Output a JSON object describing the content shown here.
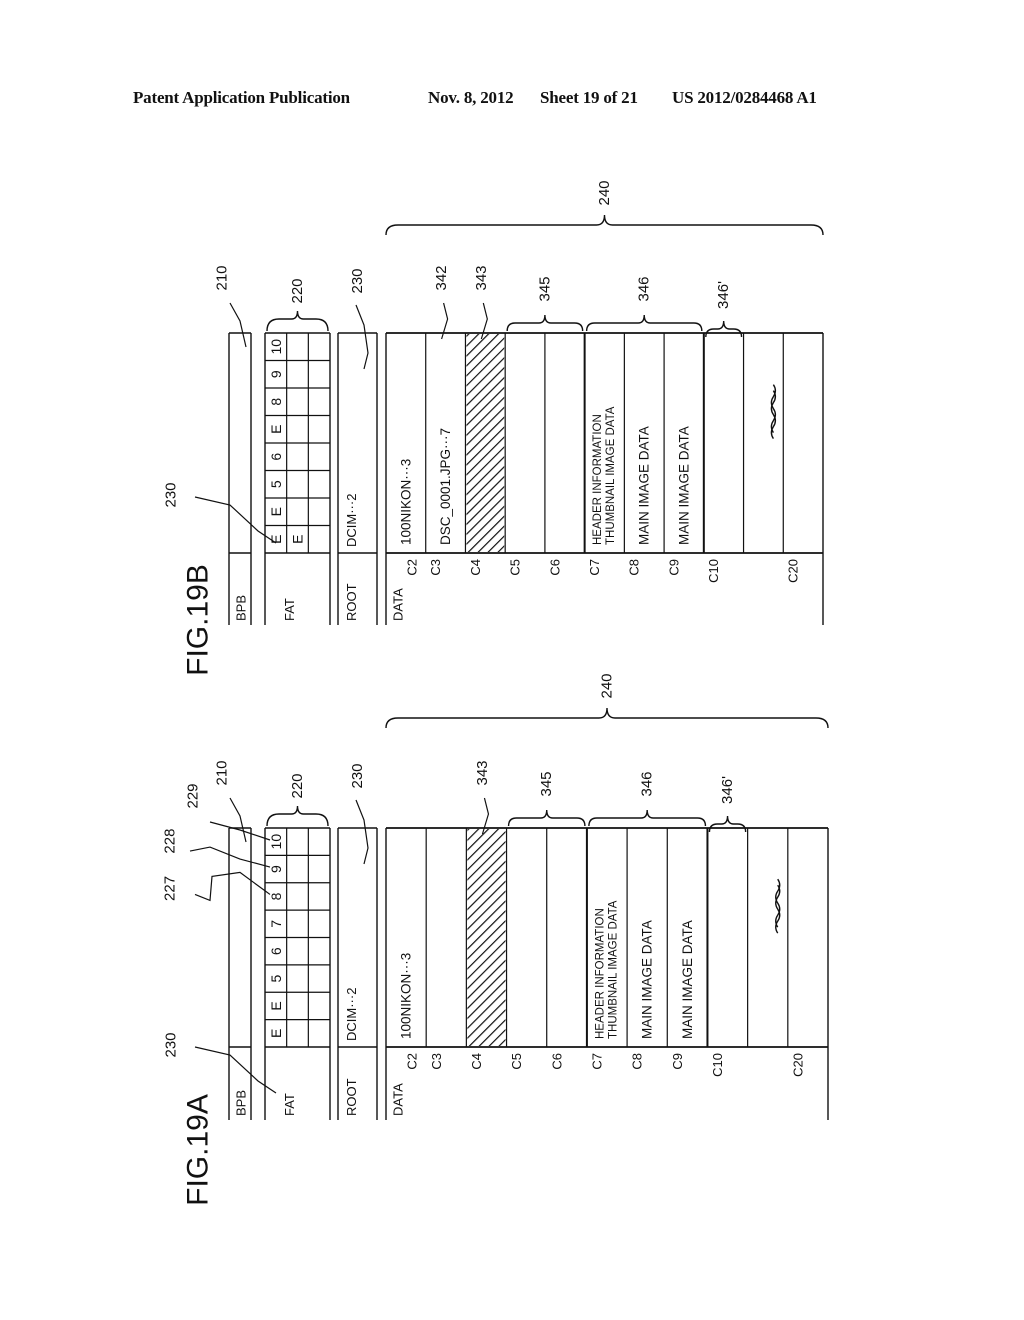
{
  "header": {
    "publication": "Patent Application Publication",
    "date": "Nov. 8, 2012",
    "sheet": "Sheet 19 of 21",
    "number": "US 2012/0284468 A1"
  },
  "figures": [
    {
      "id": "19B",
      "title": "FIG.19B",
      "regions": {
        "bpb": "BPB",
        "fat": "FAT",
        "root": "ROOT",
        "data": "DATA"
      },
      "refs": {
        "bpb": "210",
        "fat": "220",
        "root": "230",
        "data": "240",
        "fat_pointer": "230"
      },
      "fat_rows": [
        [
          "E",
          "E",
          "5",
          "6",
          "E",
          "8",
          "9",
          "10"
        ],
        [
          "E",
          "",
          "",
          "",
          "",
          "",
          "",
          ""
        ],
        [
          "",
          "",
          "",
          "",
          "",
          "",
          "",
          ""
        ]
      ],
      "root_entry": "DCIM···2",
      "clusters": [
        {
          "label": "C2",
          "content": [
            "100NIKON···3"
          ],
          "hatched": false
        },
        {
          "label": "C3",
          "content": [
            "DSC_0001.JPG···7"
          ],
          "hatched": false
        },
        {
          "label": "C4",
          "content": [],
          "hatched": true
        },
        {
          "label": "C5",
          "content": [],
          "hatched": false
        },
        {
          "label": "C6",
          "content": [],
          "hatched": false
        },
        {
          "label": "C7",
          "content": [
            "HEADER INFORMATION",
            "THUMBNAIL IMAGE DATA"
          ],
          "hatched": false
        },
        {
          "label": "C8",
          "content": [
            "MAIN IMAGE DATA"
          ],
          "hatched": false
        },
        {
          "label": "C9",
          "content": [
            "MAIN IMAGE DATA"
          ],
          "hatched": false
        },
        {
          "label": "C10",
          "content": [],
          "hatched": false
        },
        {
          "label": "",
          "content": [],
          "hatched": false
        },
        {
          "label": "C20",
          "content": [],
          "hatched": false
        }
      ],
      "cluster_refs": [
        {
          "text": "342",
          "kind": "leader",
          "cluster": 1
        },
        {
          "text": "343",
          "kind": "leader",
          "cluster": 2
        },
        {
          "text": "345",
          "kind": "brace",
          "from": 3,
          "to": 4
        },
        {
          "text": "346",
          "kind": "brace",
          "from": 5,
          "to": 7
        },
        {
          "text": "346'",
          "kind": "brace",
          "from": 8,
          "to": 8
        }
      ],
      "break_symbol": "≈"
    },
    {
      "id": "19A",
      "title": "FIG.19A",
      "regions": {
        "bpb": "BPB",
        "fat": "FAT",
        "root": "ROOT",
        "data": "DATA"
      },
      "refs": {
        "bpb": "210",
        "fat": "220",
        "root": "230",
        "data": "240",
        "fat_pointer": "230",
        "entry_227": "227",
        "entry_228": "228",
        "entry_229": "229"
      },
      "fat_rows": [
        [
          "E",
          "E",
          "5",
          "6",
          "7",
          "8",
          "9",
          "10"
        ],
        [
          "",
          "",
          "",
          "",
          "",
          "",
          "",
          ""
        ],
        [
          "",
          "",
          "",
          "",
          "",
          "",
          "",
          ""
        ]
      ],
      "root_entry": "DCIM···2",
      "clusters": [
        {
          "label": "C2",
          "content": [
            "100NIKON···3"
          ],
          "hatched": false
        },
        {
          "label": "C3",
          "content": [],
          "hatched": false
        },
        {
          "label": "C4",
          "content": [],
          "hatched": true
        },
        {
          "label": "C5",
          "content": [],
          "hatched": false
        },
        {
          "label": "C6",
          "content": [],
          "hatched": false
        },
        {
          "label": "C7",
          "content": [
            "HEADER INFORMATION",
            "THUMBNAIL IMAGE DATA"
          ],
          "hatched": false
        },
        {
          "label": "C8",
          "content": [
            "MAIN IMAGE DATA"
          ],
          "hatched": false
        },
        {
          "label": "C9",
          "content": [
            "MAIN IMAGE DATA"
          ],
          "hatched": false
        },
        {
          "label": "C10",
          "content": [],
          "hatched": false
        },
        {
          "label": "",
          "content": [],
          "hatched": false
        },
        {
          "label": "C20",
          "content": [],
          "hatched": false
        }
      ],
      "cluster_refs": [
        {
          "text": "343",
          "kind": "leader",
          "cluster": 2
        },
        {
          "text": "345",
          "kind": "brace",
          "from": 3,
          "to": 4
        },
        {
          "text": "346",
          "kind": "brace",
          "from": 5,
          "to": 7
        },
        {
          "text": "346'",
          "kind": "brace",
          "from": 8,
          "to": 8
        }
      ],
      "break_symbol": "≈"
    }
  ]
}
